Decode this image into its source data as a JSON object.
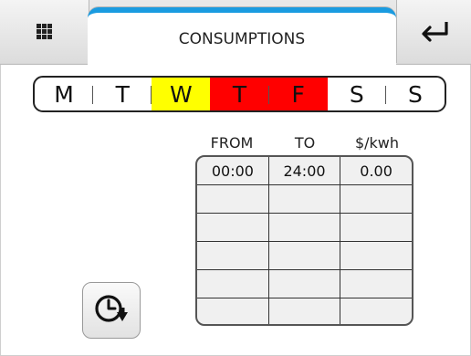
{
  "header": {
    "title": "CONSUMPTIONS",
    "menu_icon": "grid-menu-icon",
    "back_icon": "return-arrow-icon",
    "accent_color": "#1a9be0"
  },
  "days": [
    {
      "label": "M",
      "color": "#ffffff"
    },
    {
      "label": "T",
      "color": "#ffffff"
    },
    {
      "label": "W",
      "color": "#ffff00"
    },
    {
      "label": "T",
      "color": "#ff0000"
    },
    {
      "label": "F",
      "color": "#ff0000"
    },
    {
      "label": "S",
      "color": "#ffffff"
    },
    {
      "label": "S",
      "color": "#ffffff"
    }
  ],
  "table": {
    "headers": [
      "FROM",
      "TO",
      "$/kwh"
    ],
    "rows": [
      [
        "00:00",
        "24:00",
        "0.00"
      ],
      [
        "",
        "",
        ""
      ],
      [
        "",
        "",
        ""
      ],
      [
        "",
        "",
        ""
      ],
      [
        "",
        "",
        ""
      ],
      [
        "",
        "",
        ""
      ]
    ]
  },
  "schedule_button": {
    "icon": "clock-download-icon"
  }
}
